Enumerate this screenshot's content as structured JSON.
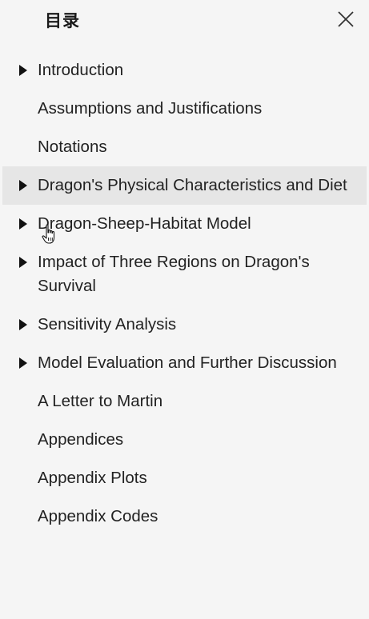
{
  "header": {
    "title": "目录",
    "close_icon": "close-icon"
  },
  "toc": {
    "items": [
      {
        "label": "Introduction",
        "expandable": true
      },
      {
        "label": "Assumptions and Justifications",
        "expandable": false
      },
      {
        "label": "Notations",
        "expandable": false
      },
      {
        "label": "Dragon's Physical Characteristics and Diet",
        "expandable": true,
        "hovered": true
      },
      {
        "label": "Dragon-Sheep-Habitat Model",
        "expandable": true
      },
      {
        "label": "Impact of Three Regions on Dragon's Survival",
        "expandable": true
      },
      {
        "label": "Sensitivity Analysis",
        "expandable": true
      },
      {
        "label": "Model Evaluation and Further Discussion",
        "expandable": true
      },
      {
        "label": "A Letter to Martin",
        "expandable": false
      },
      {
        "label": "Appendices",
        "expandable": false
      },
      {
        "label": "Appendix Plots",
        "expandable": false
      },
      {
        "label": "Appendix Codes",
        "expandable": false
      }
    ]
  },
  "colors": {
    "background": "#f5f5f5",
    "hover_background": "#e6e6e6",
    "text": "#222222"
  },
  "cursor_icon": "hand-pointer-icon"
}
